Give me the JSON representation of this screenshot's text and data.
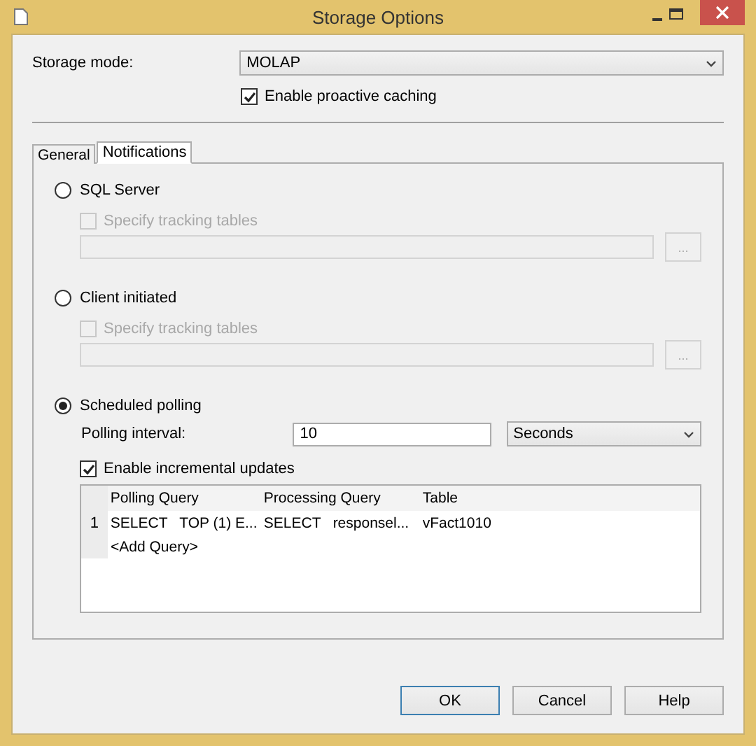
{
  "window": {
    "title": "Storage Options"
  },
  "storage_mode": {
    "label": "Storage mode:",
    "value": "MOLAP"
  },
  "proactive_caching": {
    "label": "Enable proactive caching",
    "checked": true
  },
  "tabs": [
    {
      "label": "General",
      "selected": false
    },
    {
      "label": "Notifications",
      "selected": true
    }
  ],
  "notification_options": [
    {
      "kind": "tracking",
      "label": "SQL Server",
      "selected": false,
      "tracking": {
        "label": "Specify tracking tables",
        "checked": false,
        "disabled": true
      },
      "browse_button": "..."
    },
    {
      "kind": "tracking",
      "label": "Client initiated",
      "selected": false,
      "tracking": {
        "label": "Specify tracking tables",
        "checked": false,
        "disabled": true
      },
      "browse_button": "..."
    },
    {
      "kind": "polling",
      "label": "Scheduled polling",
      "selected": true,
      "interval_label": "Polling interval:",
      "interval_value": "10",
      "unit": "Seconds",
      "incremental": {
        "label": "Enable incremental updates",
        "checked": true
      },
      "table": {
        "columns": [
          "Polling Query",
          "Processing Query",
          "Table"
        ],
        "rows": [
          {
            "number": "1",
            "cells": [
              "SELECT   TOP (1) E...",
              "SELECT   responsel...",
              "vFact1010"
            ]
          }
        ],
        "add_row": "<Add Query>"
      }
    }
  ],
  "buttons": [
    {
      "label": "OK",
      "default": true
    },
    {
      "label": "Cancel",
      "default": false
    },
    {
      "label": "Help",
      "default": false
    }
  ]
}
